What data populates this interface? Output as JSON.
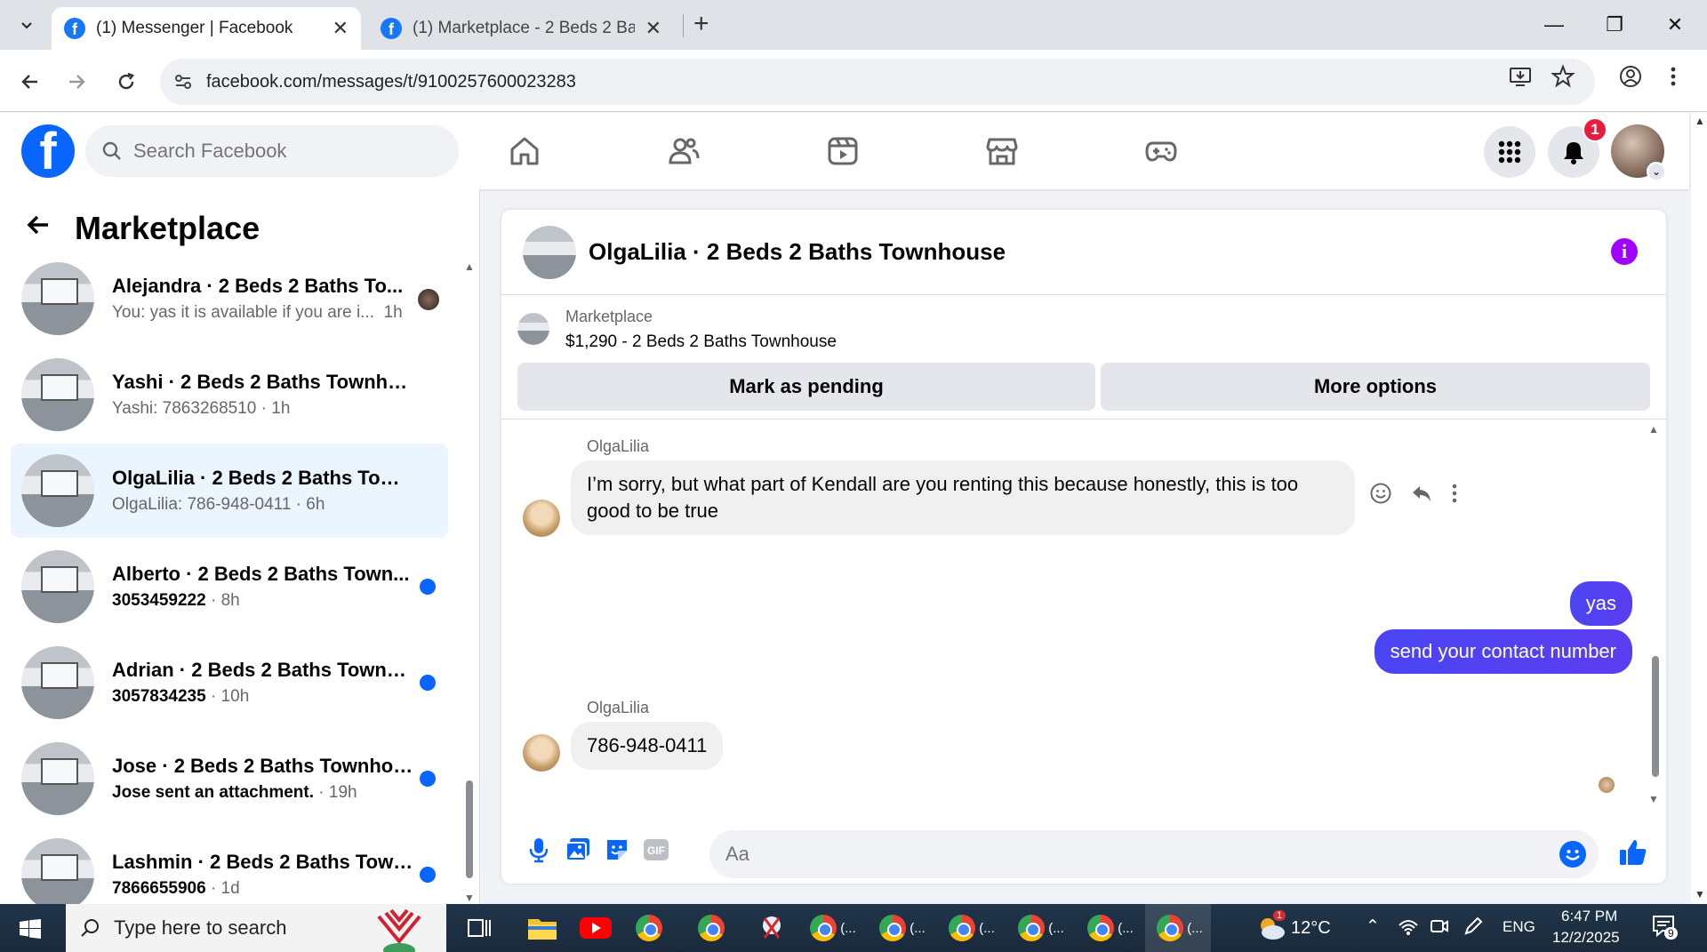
{
  "browser": {
    "tabs": [
      {
        "title": "(1) Messenger | Facebook",
        "active": true
      },
      {
        "title": "(1) Marketplace - 2 Beds 2 Bath",
        "active": false
      }
    ],
    "url": "facebook.com/messages/t/9100257600023283"
  },
  "fb": {
    "search_placeholder": "Search Facebook",
    "notifications_count": "1",
    "brand_color": "#0866ff"
  },
  "sidebar": {
    "title": "Marketplace",
    "chats": [
      {
        "name": "Alejandra · 2 Beds 2 Baths To...",
        "preview": "You: yas it is available if you are i...",
        "time": "1h",
        "unread": false,
        "selected": false
      },
      {
        "name": "Yashi · 2 Beds 2 Baths Townhouse",
        "preview": "Yashi: 7863268510",
        "time": "1h",
        "unread": false,
        "selected": false
      },
      {
        "name": "OlgaLilia · 2 Beds 2 Baths Townh...",
        "preview": "OlgaLilia: 786-948-0411",
        "time": "6h",
        "unread": false,
        "selected": true
      },
      {
        "name": "Alberto · 2 Beds 2 Baths Town...",
        "preview": "3053459222",
        "time": "8h",
        "unread": true,
        "selected": false
      },
      {
        "name": "Adrian · 2 Beds 2 Baths Townh...",
        "preview": "3057834235",
        "time": "10h",
        "unread": true,
        "selected": false
      },
      {
        "name": "Jose · 2 Beds 2 Baths Townhou...",
        "preview": "Jose sent an attachment.",
        "time": "19h",
        "unread": true,
        "selected": false
      },
      {
        "name": "Lashmin · 2 Beds 2 Baths Town...",
        "preview": "7866655906",
        "time": "1d",
        "unread": true,
        "selected": false
      }
    ]
  },
  "conversation": {
    "title": "OlgaLilia · 2 Beds 2 Baths Townhouse",
    "listing_category": "Marketplace",
    "listing_desc": "$1,290 - 2 Beds 2 Baths Townhouse",
    "mark_pending_label": "Mark as pending",
    "more_options_label": "More options",
    "messages": [
      {
        "sender": "OlgaLilia",
        "text": "I’m sorry, but what part of Kendall are you renting this because honestly, this is too good to be true"
      },
      {
        "sender": "me",
        "text": "yas"
      },
      {
        "sender": "me",
        "text": "send your contact number"
      },
      {
        "sender": "OlgaLilia",
        "text": "786-948-0411"
      }
    ],
    "composer_placeholder": "Aa",
    "accent_color": "#4c3ff5"
  },
  "taskbar": {
    "search_placeholder": "Type here to search",
    "chrome_items": [
      "(...",
      "(...",
      "(...",
      "(...",
      "(...",
      "(..."
    ],
    "weather": "12°C",
    "weather_badge": "1",
    "language": "ENG",
    "time": "6:47 PM",
    "date": "12/2/2025",
    "notifications": "9"
  }
}
